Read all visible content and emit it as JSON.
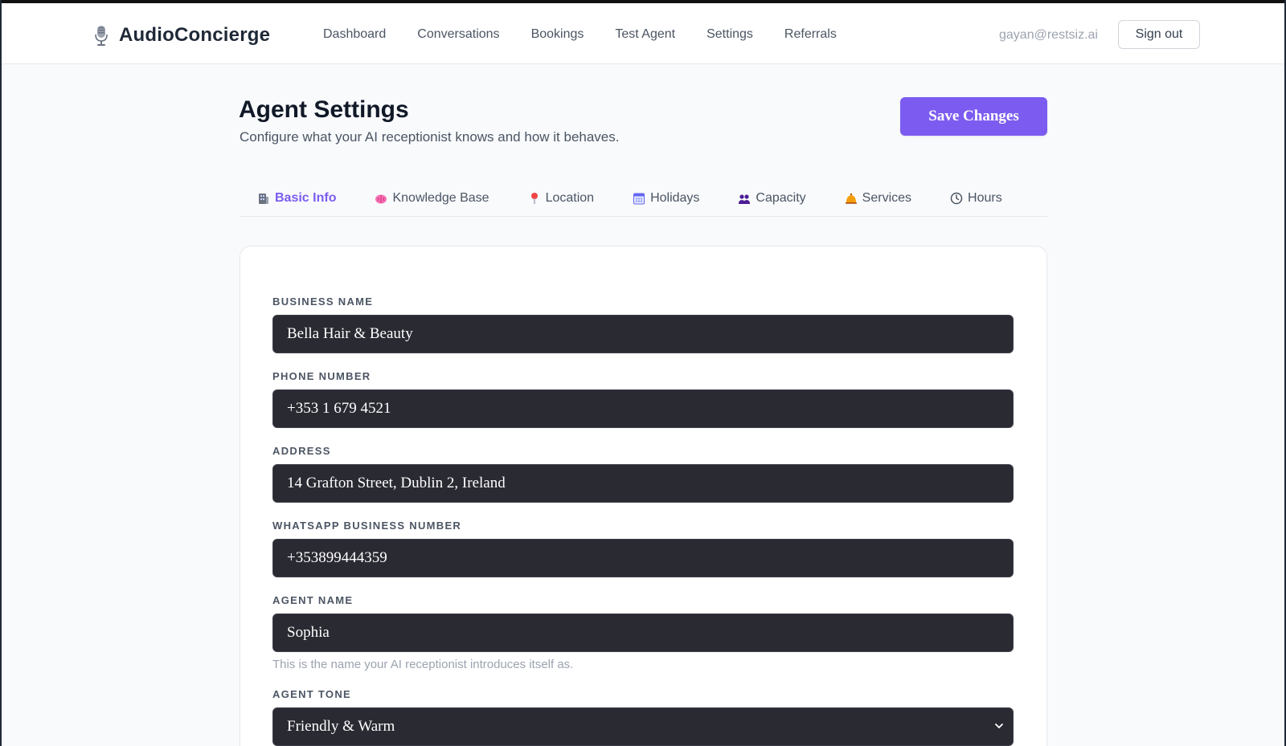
{
  "brand": {
    "name": "AudioConcierge",
    "icon": "microphone-icon"
  },
  "nav": {
    "items": [
      "Dashboard",
      "Conversations",
      "Bookings",
      "Test Agent",
      "Settings",
      "Referrals"
    ]
  },
  "user": {
    "email": "gayan@restsiz.ai",
    "signout_label": "Sign out"
  },
  "page": {
    "title": "Agent Settings",
    "subtitle": "Configure what your AI receptionist knows and how it behaves.",
    "save_label": "Save Changes"
  },
  "tabs": [
    {
      "label": "Basic Info",
      "icon": "building-icon",
      "active": true
    },
    {
      "label": "Knowledge Base",
      "icon": "brain-icon",
      "active": false
    },
    {
      "label": "Location",
      "icon": "pin-icon",
      "active": false
    },
    {
      "label": "Holidays",
      "icon": "calendar-icon",
      "active": false
    },
    {
      "label": "Capacity",
      "icon": "people-icon",
      "active": false
    },
    {
      "label": "Services",
      "icon": "bell-icon",
      "active": false
    },
    {
      "label": "Hours",
      "icon": "clock-icon",
      "active": false
    }
  ],
  "form": {
    "business_name": {
      "label": "BUSINESS NAME",
      "value": "Bella Hair & Beauty"
    },
    "phone_number": {
      "label": "PHONE NUMBER",
      "value": "+353 1 679 4521"
    },
    "address": {
      "label": "ADDRESS",
      "value": "14 Grafton Street, Dublin 2, Ireland"
    },
    "whatsapp_number": {
      "label": "WHATSAPP BUSINESS NUMBER",
      "value": "+353899444359"
    },
    "agent_name": {
      "label": "AGENT NAME",
      "value": "Sophia",
      "help": "This is the name your AI receptionist introduces itself as."
    },
    "agent_tone": {
      "label": "AGENT TONE",
      "value": "Friendly & Warm"
    }
  },
  "colors": {
    "accent": "#7c5cf0",
    "input_bg": "#2a2a33",
    "page_bg": "#f8fafc"
  }
}
